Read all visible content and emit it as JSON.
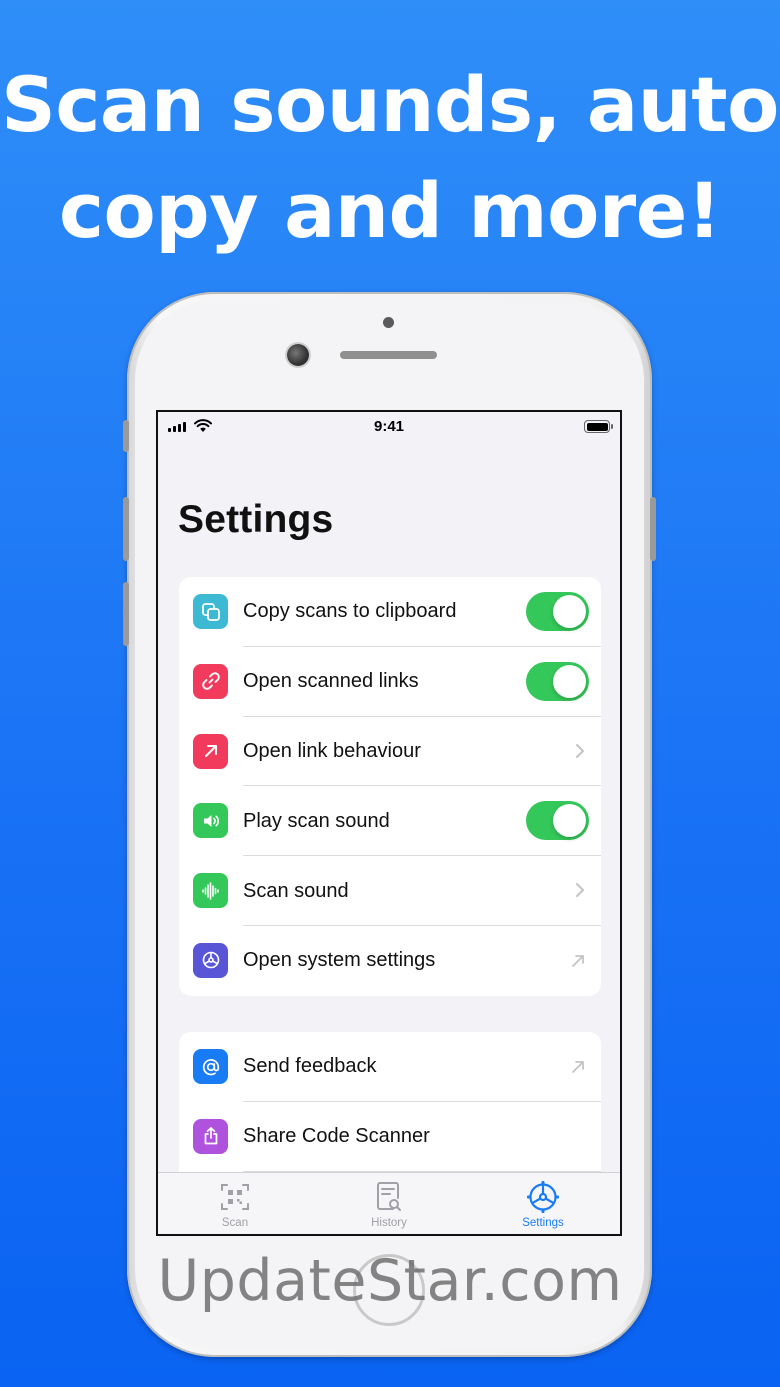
{
  "headline": {
    "line1": "Scan sounds, auto",
    "line2": "copy and more!"
  },
  "status_bar": {
    "time": "9:41"
  },
  "screen": {
    "title": "Settings"
  },
  "settings_group_1": [
    {
      "label": "Copy scans to clipboard",
      "icon": "copy-icon",
      "icon_color": "#3db9d3",
      "accessory": "toggle",
      "value": true
    },
    {
      "label": "Open scanned links",
      "icon": "link-icon",
      "icon_color": "#f23a5c",
      "accessory": "toggle",
      "value": true
    },
    {
      "label": "Open link behaviour",
      "icon": "arrow-up-right-icon",
      "icon_color": "#f23a5c",
      "accessory": "chevron"
    },
    {
      "label": "Play scan sound",
      "icon": "speaker-icon",
      "icon_color": "#34c759",
      "accessory": "toggle",
      "value": true
    },
    {
      "label": "Scan sound",
      "icon": "waveform-icon",
      "icon_color": "#34c759",
      "accessory": "chevron"
    },
    {
      "label": "Open system settings",
      "icon": "gear-icon",
      "icon_color": "#5856d6",
      "accessory": "external-arrow"
    }
  ],
  "settings_group_2": [
    {
      "label": "Send feedback",
      "icon": "at-icon",
      "icon_color": "#1a7cf4",
      "accessory": "external-arrow"
    },
    {
      "label": "Share Code Scanner",
      "icon": "share-icon",
      "icon_color": "#af52de",
      "accessory": "none"
    }
  ],
  "tab_bar": [
    {
      "label": "Scan",
      "icon": "qr-scan-icon",
      "active": false
    },
    {
      "label": "History",
      "icon": "document-search-icon",
      "active": false
    },
    {
      "label": "Settings",
      "icon": "gear-icon",
      "active": true
    }
  ],
  "colors": {
    "background": "#1a73f5",
    "toggle_on": "#34c759",
    "accent": "#1a7cf4"
  },
  "watermark": "UpdateStar.com"
}
